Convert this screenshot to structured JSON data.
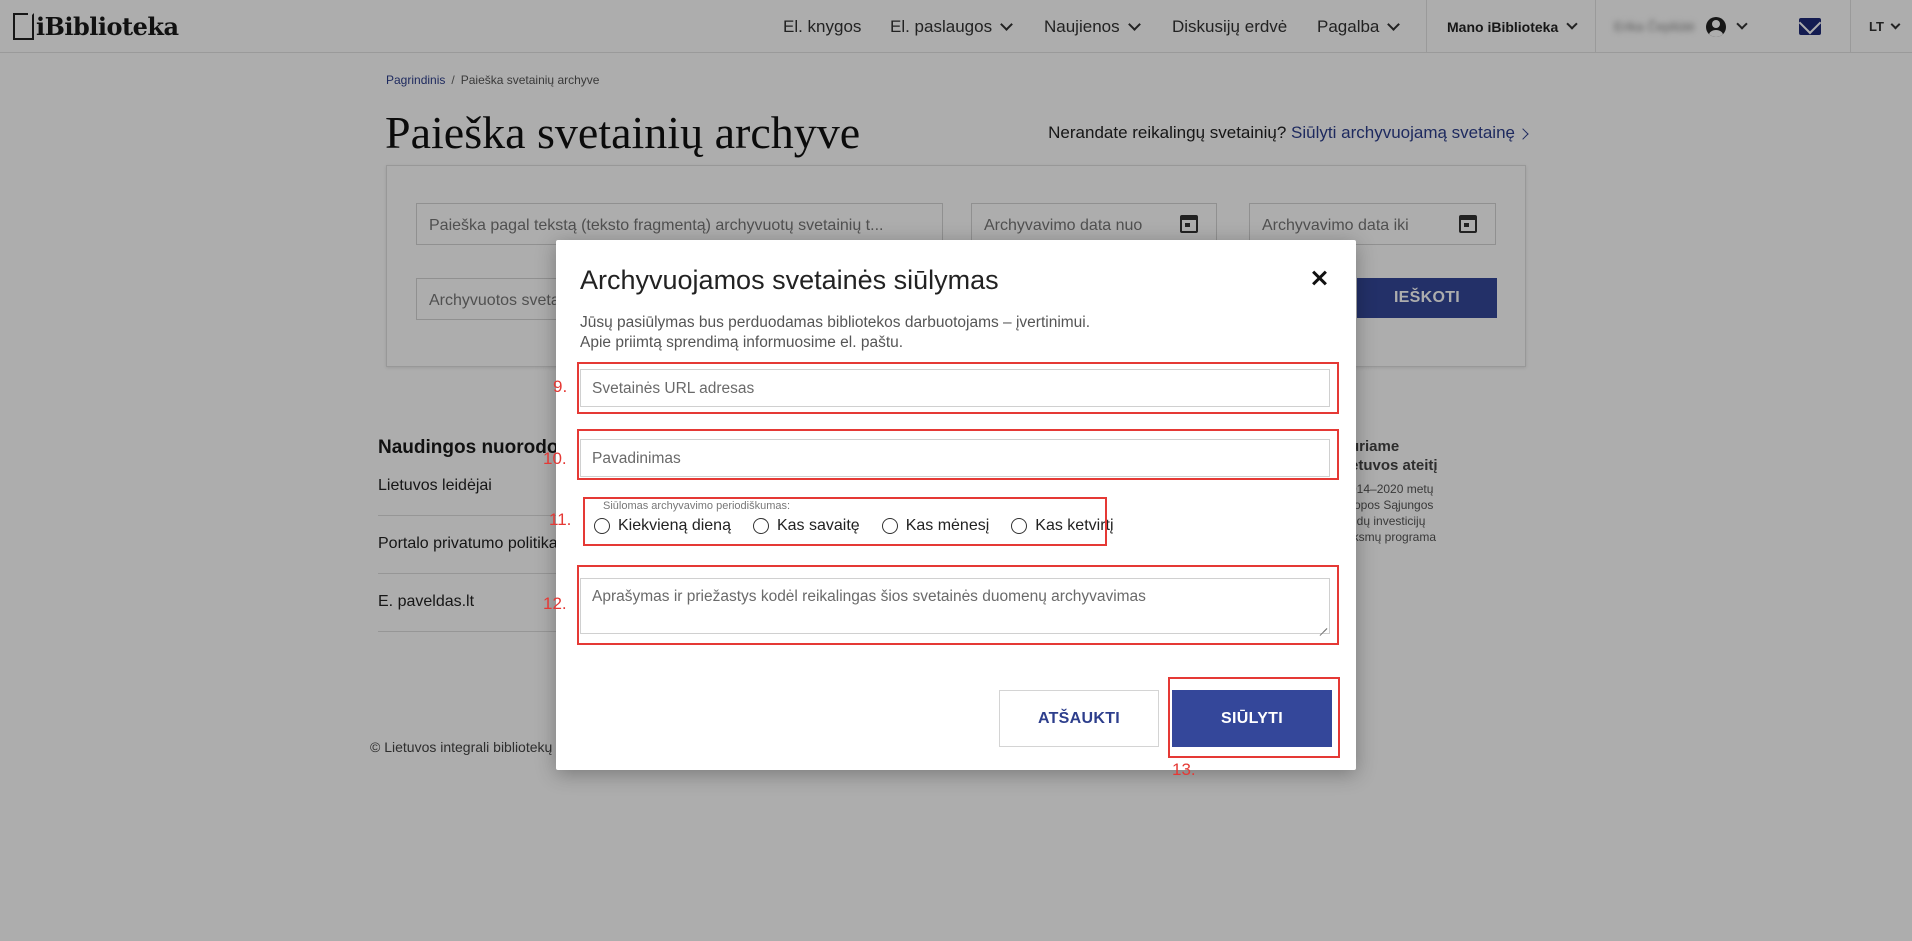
{
  "header": {
    "logo_text": "iBiblioteka",
    "nav": {
      "ebooks": "El. knygos",
      "eservices": "El. paslaugos",
      "news": "Naujienos",
      "discussions": "Diskusijų erdvė",
      "help": "Pagalba",
      "my_library": "Mano iBiblioteka",
      "user_name": "Erika Čepliūtė",
      "language": "LT"
    }
  },
  "breadcrumb": {
    "home": "Pagrindinis",
    "separator": "/",
    "current": "Paieška svetainių archyve"
  },
  "page": {
    "title": "Paieška svetainių archyve",
    "suggest_prompt": "Nerandate reikalingų svetainių?",
    "suggest_link": "Siūlyti archyvuojamą svetainę"
  },
  "search": {
    "text_placeholder": "Paieška pagal tekstą (teksto fragmentą) archyvuotų svetainių t...",
    "date_from_placeholder": "Archyvavimo data nuo",
    "date_to_placeholder": "Archyvavimo data iki",
    "site_placeholder": "Archyvuotos sveta",
    "search_button": "IEŠKOTI"
  },
  "footer": {
    "useful_title": "Naudingos nuorodo",
    "links": [
      "Lietuvos leidėjai",
      "Portalo privatumo politika",
      "E. paveldas.lt"
    ],
    "eu_line1": "uriame",
    "eu_line2": "etuvos ateitį",
    "eu_small": [
      "014–2020 metų",
      "ropos Sąjungos",
      "ndų investicijų",
      "iksmų programa"
    ],
    "copyright": "© Lietuvos integrali bibliotekų"
  },
  "modal": {
    "title": "Archyvuojamos svetainės siūlymas",
    "desc_line1": "Jūsų pasiūlymas bus perduodamas bibliotekos darbuotojams – įvertinimui.",
    "desc_line2": "Apie priimtą sprendimą informuosime el. paštu.",
    "url_placeholder": "Svetainės URL adresas",
    "name_placeholder": "Pavadinimas",
    "frequency_legend": "Siūlomas archyvavimo periodiškumas:",
    "frequency_options": [
      "Kiekvieną dieną",
      "Kas savaitę",
      "Kas mėnesį",
      "Kas ketvirtį"
    ],
    "description_placeholder": "Aprašymas ir priežastys kodėl reikalingas šios svetainės duomenų archyvavimas",
    "cancel_button": "ATŠAUKTI",
    "submit_button": "SIŪLYTI"
  },
  "annotations": [
    "9.",
    "10.",
    "11.",
    "12.",
    "13."
  ],
  "colors": {
    "accent": "#34479a",
    "link": "#2d3e8c",
    "annotation": "#e53935"
  }
}
